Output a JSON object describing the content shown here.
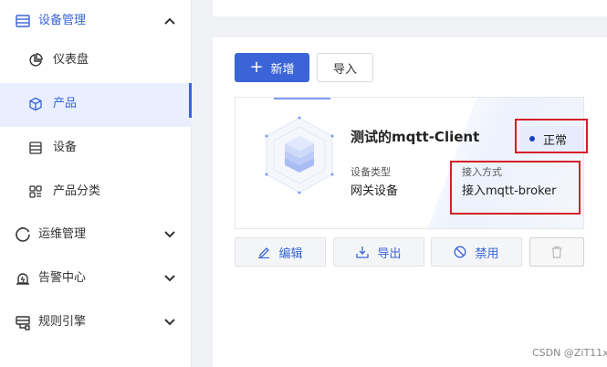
{
  "sidebar": {
    "groups": [
      {
        "label": "设备管理",
        "icon": "device-manage-icon",
        "expanded": true
      },
      {
        "label": "运维管理",
        "icon": "ops-icon",
        "expanded": false
      },
      {
        "label": "告警中心",
        "icon": "alarm-icon",
        "expanded": false
      },
      {
        "label": "规则引擎",
        "icon": "rule-engine-icon",
        "expanded": false
      }
    ],
    "items": [
      {
        "label": "仪表盘",
        "icon": "pie-chart-icon"
      },
      {
        "label": "产品",
        "icon": "cube-icon",
        "active": true
      },
      {
        "label": "设备",
        "icon": "list-icon"
      },
      {
        "label": "产品分类",
        "icon": "category-icon"
      }
    ]
  },
  "toolbar": {
    "add_label": "新增",
    "import_label": "导入"
  },
  "product_card": {
    "name": "测试的mqtt-Client",
    "status": "正常",
    "device_type_label": "设备类型",
    "device_type_value": "网关设备",
    "access_label": "接入方式",
    "access_value": "接入mqtt-broker"
  },
  "actions": {
    "edit": "编辑",
    "export": "导出",
    "disable": "禁用"
  },
  "watermark": "CSDN @ZiT11x",
  "colors": {
    "accent": "#3a64d8",
    "highlight_box": "#d4202a",
    "status_dot": "#1a3fbf"
  }
}
